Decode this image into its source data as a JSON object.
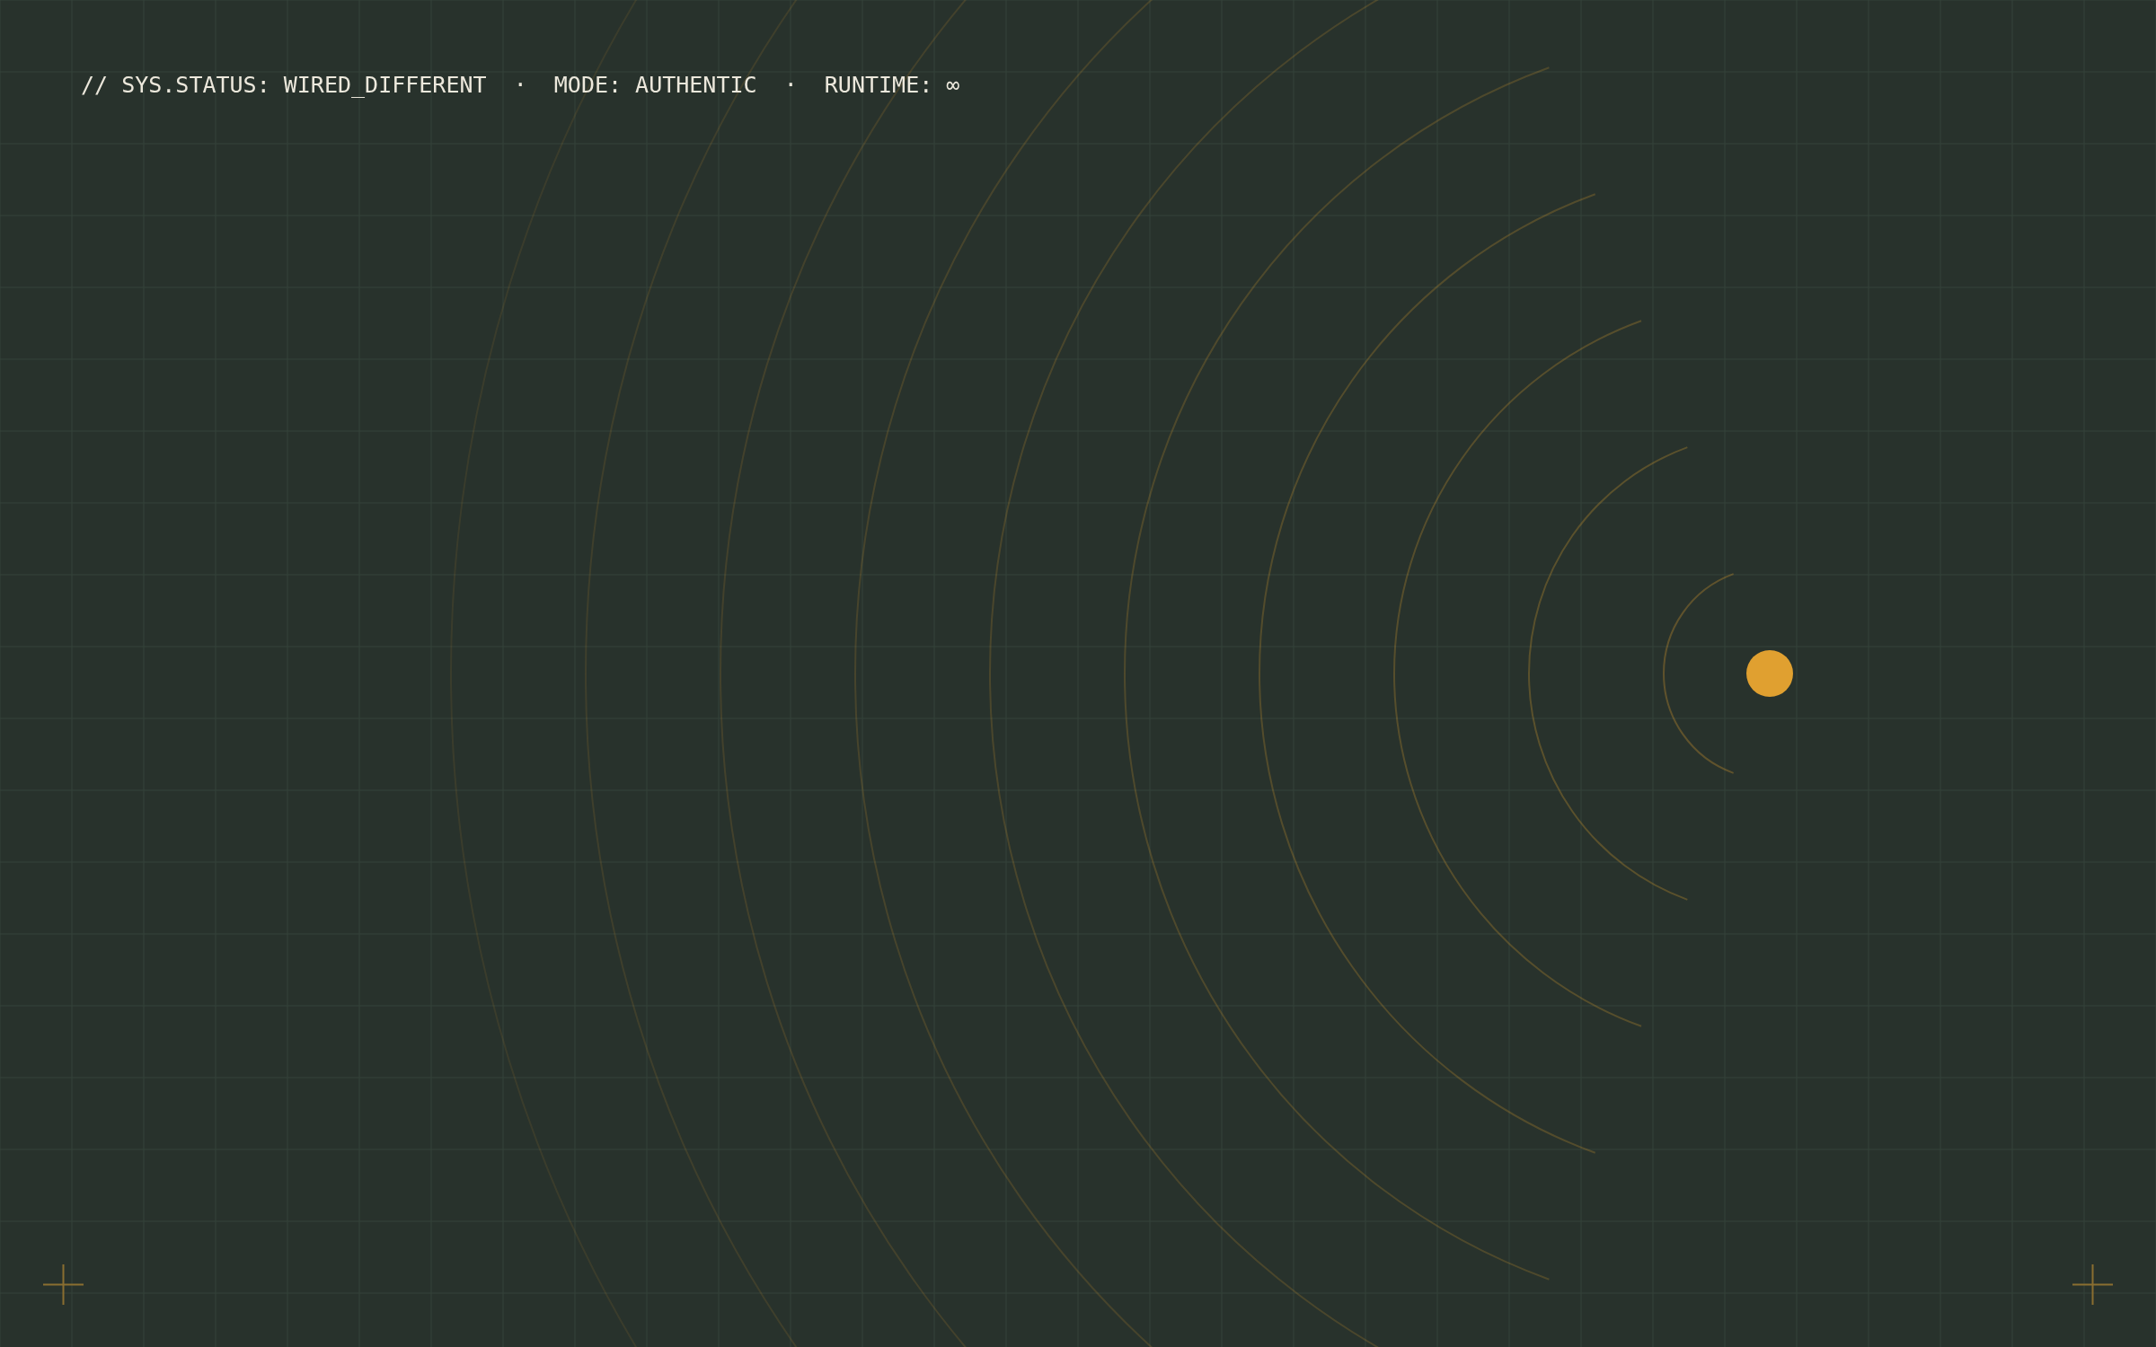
{
  "status_line": "// SYS.STATUS: WIRED_DIFFERENT  ·  MODE: AUTHENTIC  ·  RUNTIME: ∞"
}
